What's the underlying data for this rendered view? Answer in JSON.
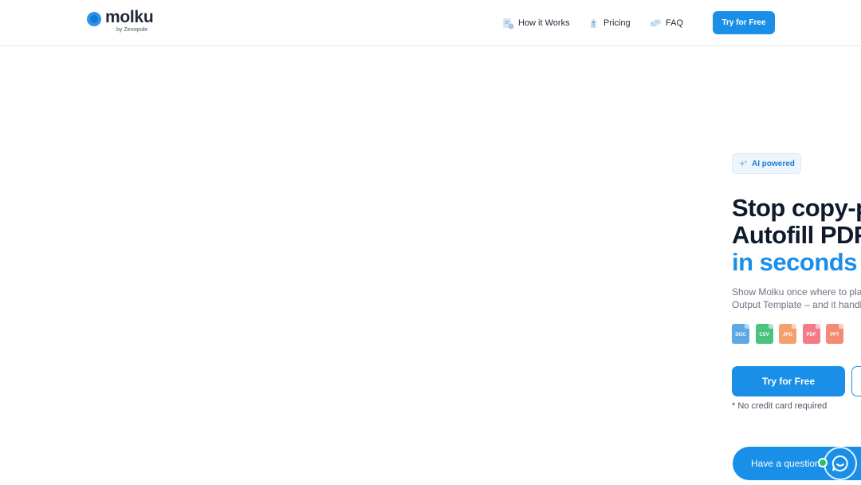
{
  "brand": {
    "name": "molku",
    "tagline": "by Zeroqode",
    "color": "#1a8fe8"
  },
  "nav": {
    "items": [
      {
        "label": "How it Works",
        "icon": "document-icon"
      },
      {
        "label": "Pricing",
        "icon": "tag-icon"
      },
      {
        "label": "FAQ",
        "icon": "chat-bubbles-icon"
      }
    ],
    "cta_label": "Try for Free"
  },
  "hero": {
    "badge": "AI powered",
    "headline_line1": "Stop copy-p",
    "headline_line2": "Autofill PDFs",
    "headline_line3": "in seconds",
    "description_line1": "Show Molku once where to place",
    "description_line2": "Output Template – and it handles",
    "formats": [
      {
        "label": "DOC",
        "color": "#5fa8e6"
      },
      {
        "label": "CSV",
        "color": "#4cc27f"
      },
      {
        "label": "JPG",
        "color": "#f5a06b"
      },
      {
        "label": "PDF",
        "color": "#f27b86"
      },
      {
        "label": "PPT",
        "color": "#f48a73"
      }
    ],
    "cta_label": "Try for Free",
    "note": "* No credit card required"
  },
  "chat": {
    "label": "Have a question?"
  }
}
